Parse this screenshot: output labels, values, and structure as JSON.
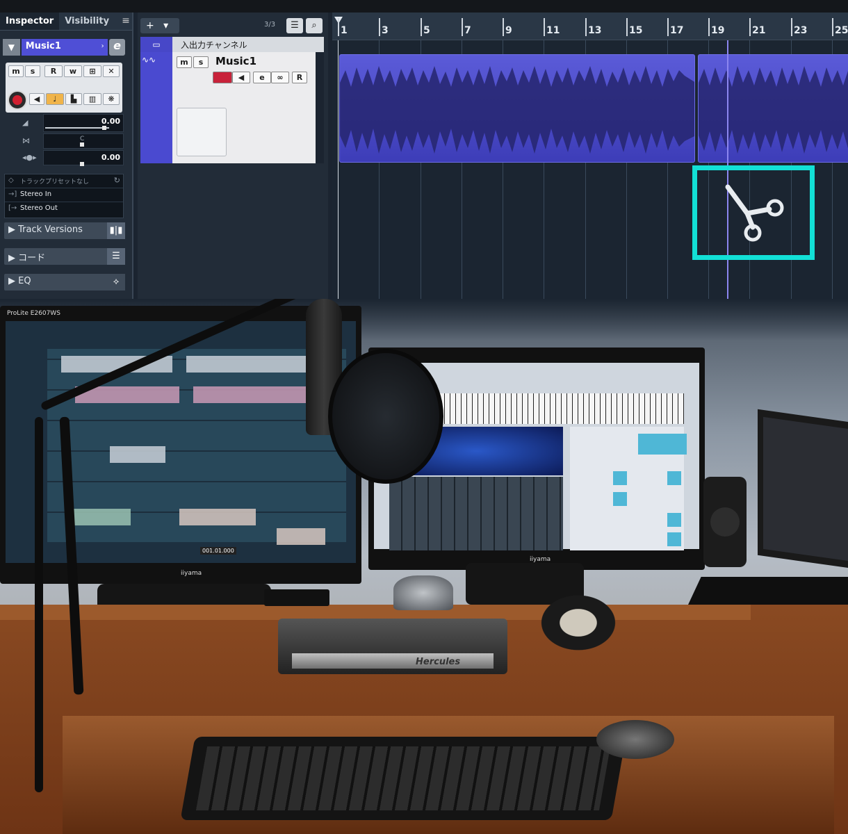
{
  "inspector": {
    "tabs": [
      {
        "label": "Inspector"
      },
      {
        "label": "Visibility"
      }
    ],
    "menu_icon": "hamburger-icon",
    "track": {
      "toggle": "▼",
      "name": "Music1",
      "arrow": "›",
      "edit_label": "e"
    },
    "buttons": {
      "mute": "m",
      "solo": "s",
      "read": "R",
      "write": "w"
    },
    "fader": {
      "volume_value": "0.00",
      "pan_value": "0.00",
      "pan_center": "C"
    },
    "routing": {
      "preset": "トラックプリセットなし",
      "input": "Stereo In",
      "output": "Stereo Out"
    },
    "sections": [
      {
        "label": "Track Versions",
        "icon": "track-versions-icon"
      },
      {
        "label": "コード",
        "icon": "chord-icon"
      },
      {
        "label": "EQ",
        "icon": "eq-icon"
      }
    ]
  },
  "tracklist": {
    "add_label": "+",
    "track_count": "3/3",
    "folder_track": {
      "name": "入出力チャンネル",
      "icon": "folder-icon"
    },
    "audio_track": {
      "name": "Music1",
      "mute": "m",
      "solo": "s",
      "read": "R"
    }
  },
  "ruler": {
    "labels": [
      "1",
      "3",
      "5",
      "7",
      "9",
      "11",
      "13",
      "15",
      "17",
      "19",
      "21",
      "23",
      "25"
    ]
  },
  "cursor_tool": "scissors-icon",
  "photo": {
    "left_monitor_brand": "iiyama",
    "left_monitor_model": "ProLite E2607WS",
    "center_monitor_brand": "iiyama",
    "screen_timecode": "001.01.000",
    "controller_brand": "Hercules"
  },
  "colors": {
    "track_color": "#4f4fd6",
    "highlight_box": "#12e0d6",
    "record": "#d22030"
  }
}
